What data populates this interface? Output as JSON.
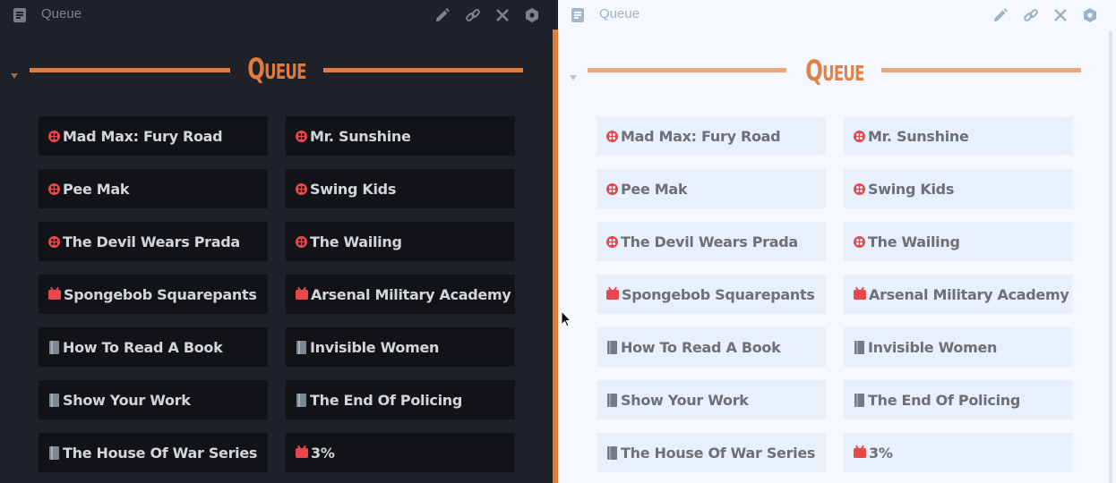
{
  "panes": [
    {
      "theme": "dark",
      "title": "Queue",
      "heading": "Queue"
    },
    {
      "theme": "light",
      "title": "Queue",
      "heading": "Queue"
    }
  ],
  "toolbar_icons": [
    "edit-icon",
    "link-icon",
    "close-icon",
    "settings-icon"
  ],
  "accent_color": "#e07b39",
  "icon_colors": {
    "movie": "#e8484c",
    "tv": "#e8484c",
    "book": "#7d8694"
  },
  "items": [
    {
      "label": "Mad Max: Fury Road",
      "type": "movie"
    },
    {
      "label": "Mr. Sunshine",
      "type": "movie"
    },
    {
      "label": "Pee Mak",
      "type": "movie"
    },
    {
      "label": "Swing Kids",
      "type": "movie"
    },
    {
      "label": "The Devil Wears Prada",
      "type": "movie"
    },
    {
      "label": "The Wailing",
      "type": "movie"
    },
    {
      "label": "Spongebob Squarepants",
      "type": "tv"
    },
    {
      "label": "Arsenal Military Academy",
      "type": "tv"
    },
    {
      "label": "How To Read A Book",
      "type": "book"
    },
    {
      "label": "Invisible Women",
      "type": "book"
    },
    {
      "label": "Show Your Work",
      "type": "book"
    },
    {
      "label": "The End Of Policing",
      "type": "book"
    },
    {
      "label": "The House Of War Series",
      "type": "book"
    },
    {
      "label": "3%",
      "type": "tv"
    }
  ]
}
